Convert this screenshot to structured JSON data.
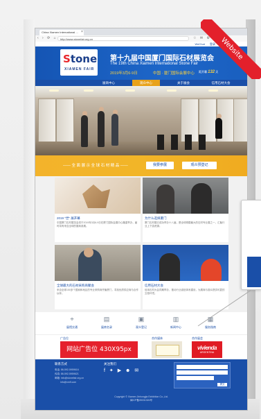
{
  "browser": {
    "tab_title": "China Xiamen International ...",
    "tab_close": "×",
    "url": "http://www.stonefair.org.cn",
    "nav_glyphs": "‹ › ⟳ ⌂",
    "toolbar_glyphs": "☆ ✉ ⚙ ⋮"
  },
  "site_top": {
    "links": [
      "WeChat",
      "登录",
      "Language ▼"
    ]
  },
  "header": {
    "logo_s": "S",
    "logo_rest": "tone",
    "logo_sub": "XIAMEN FAIR",
    "title_cn": "第十九届中国厦门国际石材展览会",
    "title_en": "The 19th China Xiamen International Stone Fair",
    "date": "2019年3月6-9日",
    "venue": "中国 · 厦门国际会展中心",
    "countdown_label": "距开幕",
    "countdown_value": "132",
    "countdown_unit": "天"
  },
  "nav": {
    "items": [
      "展商中心",
      "观众中心",
      "关于展会",
      "信用石材大会"
    ],
    "active_index": 1
  },
  "banner": {
    "text": "—— 全 面 展 示 全 球 石 材 精 品 ——",
    "btn_exhibit": "我要参展",
    "btn_visit": "观众预登记"
  },
  "news": [
    {
      "title": "2019 \"世\" 展开幕",
      "desc": "中国厦门石材展览会将于2019年3月6-9日在厦门国际会展中心隆重举办，届时将有来自全球的展商参展。"
    },
    {
      "title": "为什么选择厦门",
      "desc": "厦门石材展已成功举办十八届，是全球规模最大的石材专业展之一，汇聚行业上下游资源。"
    },
    {
      "title": "全球最大的石材采购商聚会",
      "desc": "来自全球150多个国家和地区的专业采购商齐聚厦门，寻找优质供应商与合作伙伴。"
    },
    {
      "title": "信用石材大会",
      "desc": "信用石材大会同期举办，推动行业诚信体系建设，为展商与观众提供可靠的交易环境。"
    }
  ],
  "services": [
    "展馆交通",
    "展商名录",
    "观众登记",
    "新闻中心",
    "服务指南"
  ],
  "ads": {
    "label1": "广告位",
    "ad1_text": "网站广告位 430X95px",
    "label2": "合作媒体",
    "label3": "合作展会",
    "ad3_main": "vivienda",
    "ad3_sub": "ARGENTINA"
  },
  "footer": {
    "contact_h": "联系方式",
    "contact_lines": [
      "电话: 86-592-5959616",
      "传真: 86-592-5959621",
      "邮箱: info@stonefair.org.cn",
      "info@xmfl.com"
    ],
    "follow_h": "关注我们",
    "follow_icons": "f ✦ ▶ ☻ ✉",
    "submit": "提交",
    "copyright": "Copyright © Xiamen Jinhongjia Exhibition Co.,Ltd.",
    "icp": "闽ICP备05031326号"
  },
  "ribbon_text": "Website",
  "colors": {
    "brand_blue": "#1a4fa8",
    "accent_gold": "#f2b528",
    "ribbon_red": "#e3202b"
  }
}
